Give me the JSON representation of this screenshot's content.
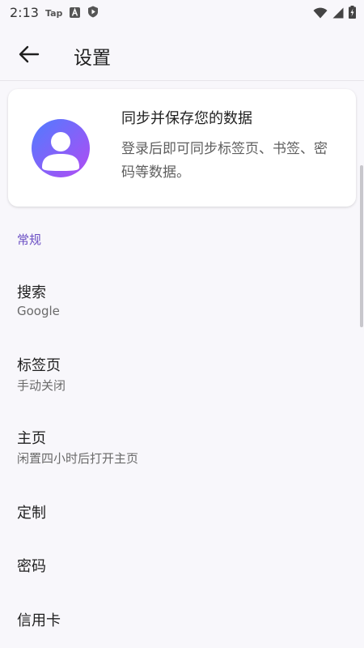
{
  "status_bar": {
    "time": "2:13",
    "tap_label": "Tap",
    "icons": [
      "tap-notification-icon",
      "a-box-icon",
      "shield-play-icon",
      "wifi-icon",
      "signal-icon",
      "battery-charging-icon"
    ]
  },
  "app_bar": {
    "back_icon": "arrow-back-icon",
    "title": "设置"
  },
  "sync_card": {
    "avatar_icon": "account-avatar-icon",
    "title": "同步并保存您的数据",
    "description": "登录后即可同步标签页、书签、密码等数据。"
  },
  "section": {
    "general_label": "常规"
  },
  "settings": [
    {
      "title": "搜索",
      "subtitle": "Google"
    },
    {
      "title": "标签页",
      "subtitle": "手动关闭"
    },
    {
      "title": "主页",
      "subtitle": "闲置四小时后打开主页"
    },
    {
      "title": "定制",
      "subtitle": ""
    },
    {
      "title": "密码",
      "subtitle": ""
    },
    {
      "title": "信用卡",
      "subtitle": ""
    }
  ],
  "colors": {
    "background": "#f8f7fb",
    "accent": "#6b4fc4",
    "avatar_gradient_start": "#4f7cff",
    "avatar_gradient_end": "#b24bf3"
  }
}
